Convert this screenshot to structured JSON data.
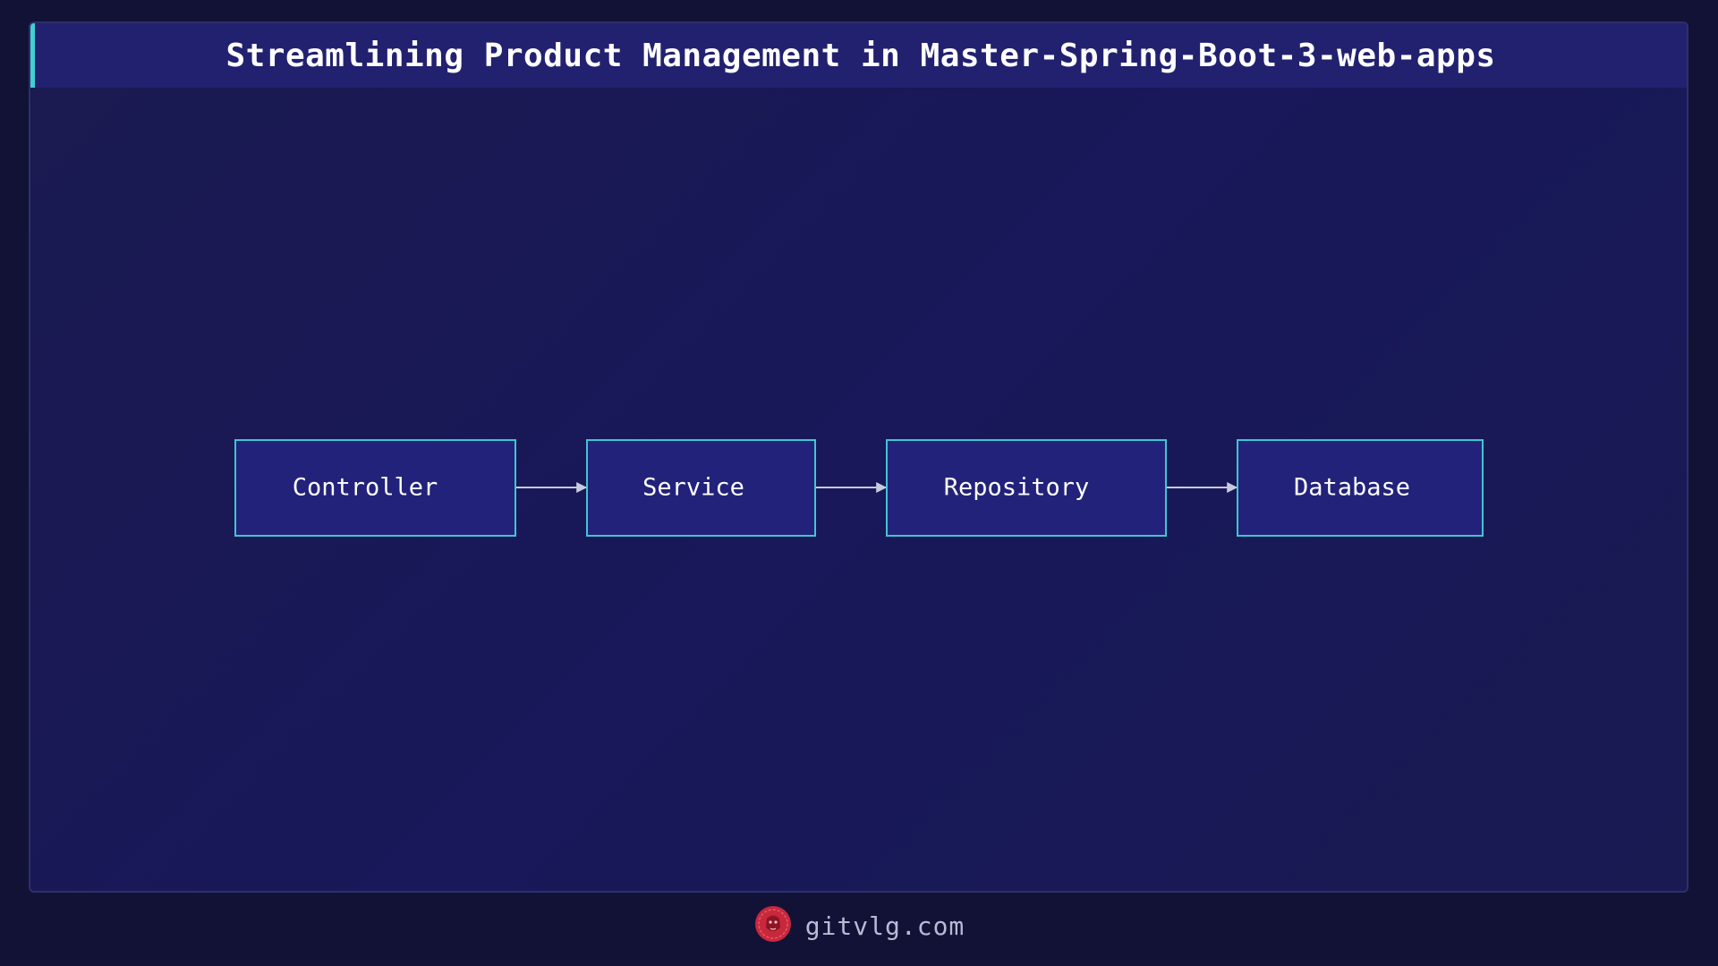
{
  "title": "Streamlining Product Management in Master-Spring-Boot-3-web-apps",
  "diagram": {
    "nodes": [
      {
        "id": "controller",
        "label": "Controller"
      },
      {
        "id": "service",
        "label": "Service"
      },
      {
        "id": "repository",
        "label": "Repository"
      },
      {
        "id": "database",
        "label": "Database"
      }
    ],
    "edges": [
      {
        "from": "controller",
        "to": "service"
      },
      {
        "from": "service",
        "to": "repository"
      },
      {
        "from": "repository",
        "to": "database"
      }
    ]
  },
  "footer": {
    "logo_icon": "lion-logo-icon",
    "text": "gitvlg.com"
  },
  "colors": {
    "background": "#121236",
    "panel": "#1b1a52",
    "title_bar": "#222170",
    "accent": "#3fd0d2",
    "node_fill": "#23227a",
    "node_border": "#3fc6d0",
    "arrow": "#c8cae0",
    "logo": "#c8283c"
  }
}
